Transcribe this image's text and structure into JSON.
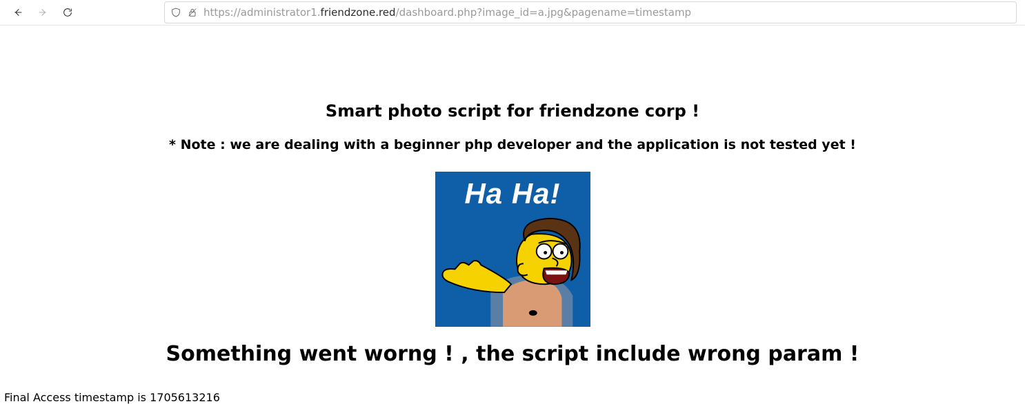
{
  "toolbar": {
    "url_scheme": "https://",
    "url_sub": "administrator1.",
    "url_host": "friendzone.red",
    "url_path": "/dashboard.php?image_id=a.jpg&pagename=timestamp"
  },
  "content": {
    "title": "Smart photo script for friendzone corp !",
    "note": "* Note : we are dealing with a beginner php developer and the application is not tested yet !",
    "meme_caption": "Ha Ha!",
    "error": "Something went worng ! , the script include wrong param !",
    "timestamp_line": "Final Access timestamp is 1705613216"
  }
}
